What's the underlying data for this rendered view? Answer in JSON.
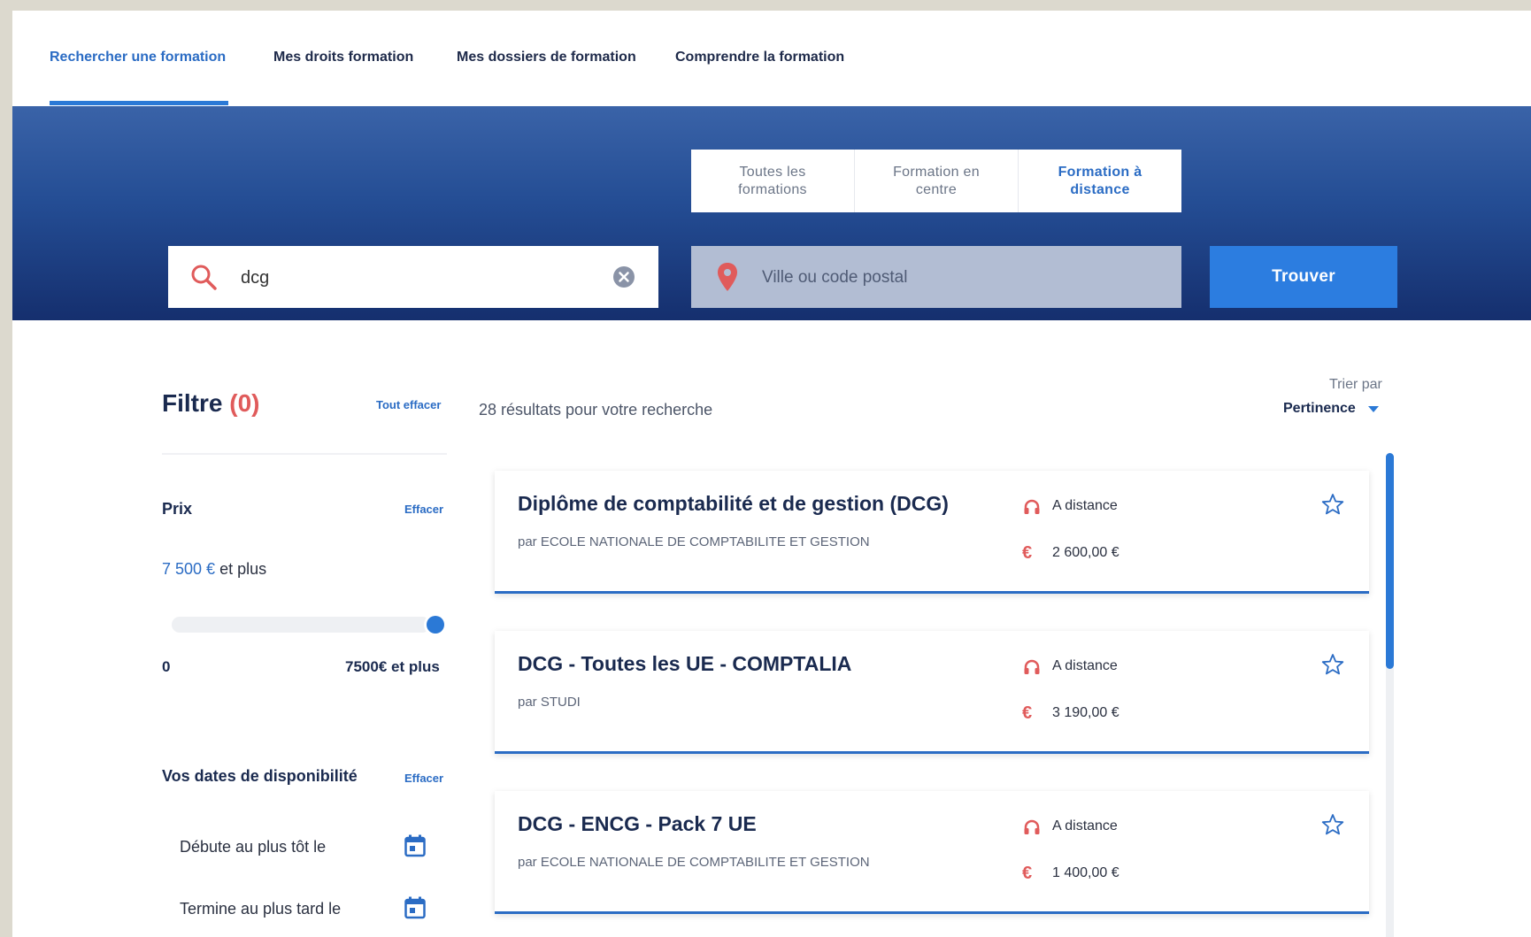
{
  "nav": {
    "tabs": [
      {
        "label": "Rechercher une formation"
      },
      {
        "label": "Mes droits formation"
      },
      {
        "label": "Mes dossiers de formation"
      },
      {
        "label": "Comprendre la formation"
      }
    ]
  },
  "hero": {
    "segments": [
      {
        "line1": "Toutes les",
        "line2": "formations"
      },
      {
        "line1": "Formation en",
        "line2": "centre"
      },
      {
        "line1": "Formation à",
        "line2": "distance"
      }
    ],
    "search_value": "dcg",
    "location_placeholder": "Ville ou code postal",
    "find_label": "Trouver"
  },
  "filters": {
    "title": "Filtre",
    "count": "(0)",
    "clear_all": "Tout effacer",
    "price": {
      "label": "Prix",
      "clear": "Effacer",
      "value_amount": "7 500 €",
      "value_suffix": " et plus",
      "min_label": "0",
      "max_label": "7500€ et plus",
      "slider_level": 1.0
    },
    "dates": {
      "label": "Vos dates de disponibilité",
      "clear": "Effacer",
      "start_label": "Débute au plus tôt le",
      "end_label": "Termine au plus tard le"
    }
  },
  "results": {
    "count_text": "28 résultats pour votre recherche",
    "sort_label": "Trier par",
    "sort_value": "Pertinence",
    "cards": [
      {
        "title": "Diplôme de comptabilité et de gestion (DCG)",
        "provider": "par ECOLE NATIONALE DE COMPTABILITE ET GESTION",
        "mode": "A distance",
        "price": "2 600,00 €"
      },
      {
        "title": "DCG - Toutes les UE - COMPTALIA",
        "provider": "par STUDI",
        "mode": "A distance",
        "price": "3 190,00 €"
      },
      {
        "title": "DCG - ENCG - Pack 7 UE",
        "provider": "par ECOLE NATIONALE DE COMPTABILITE ET GESTION",
        "mode": "A distance",
        "price": "1 400,00 €"
      }
    ]
  },
  "icons": {
    "search": "search-icon",
    "clear": "clear-circle-icon",
    "location": "map-pin-icon",
    "calendar": "calendar-icon",
    "headphones": "headphones-icon",
    "euro": "euro-icon",
    "star": "star-outline-icon"
  },
  "colors": {
    "accent": "#2b79d6",
    "primary_text": "#1a2a4f",
    "alert": "#e05b5b",
    "hero_top": "#3a63a8",
    "hero_bottom": "#152f6e",
    "euro_symbol": "€"
  }
}
